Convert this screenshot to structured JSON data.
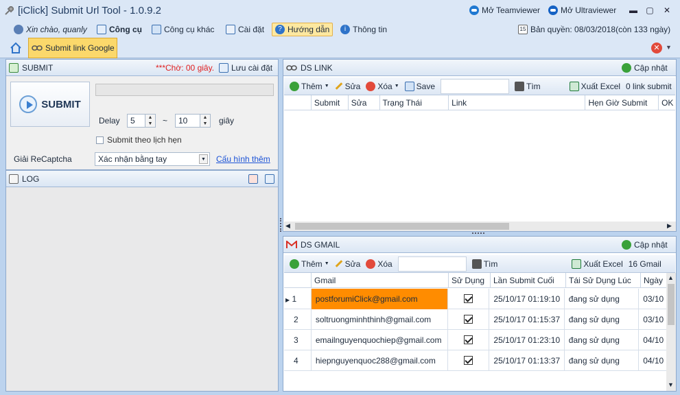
{
  "window": {
    "title": "[iClick] Submit Url Tool - 1.0.9.2",
    "teamviewer": "Mở Teamviewer",
    "ultraviewer": "Mở Ultraviewer",
    "minimize": "▬",
    "maximize": "▢",
    "close": "✕"
  },
  "menu": {
    "greeting": "Xin chào, quanly",
    "items": [
      "Công cụ",
      "Công cụ khác",
      "Cài đặt",
      "Hướng dẫn",
      "Thông tin"
    ],
    "license": "Bản quyền: 08/03/2018(còn 133 ngày)"
  },
  "tabs": {
    "active": "Submit link Google",
    "close": "✕",
    "dropdown": "▼"
  },
  "submit_panel": {
    "title": "SUBMIT",
    "wait_status": "***Chờ: 00 giây.",
    "save_settings": "Lưu cài đặt",
    "submit_button": "SUBMIT",
    "delay_label": "Delay",
    "delay_min": "5",
    "delay_sep": "~",
    "delay_max": "10",
    "delay_unit": "giây",
    "schedule_label": "Submit theo lịch hẹn",
    "recaptcha_label": "Giải ReCaptcha",
    "recaptcha_value": "Xác nhận bằng tay",
    "config_more": "Cấu hình thêm"
  },
  "log_panel": {
    "title": "LOG"
  },
  "dslink": {
    "title": "DS LINK",
    "update": "Cập nhật",
    "add": "Thêm",
    "edit": "Sửa",
    "delete": "Xóa",
    "save": "Save",
    "search": "Tìm",
    "export": "Xuất Excel",
    "count": "0 link submit",
    "columns": [
      "Submit",
      "Sửa",
      "Trạng Thái",
      "Link",
      "Hẹn Giờ Submit",
      "OK"
    ]
  },
  "dsgmail": {
    "title": "DS GMAIL",
    "update": "Cập nhật",
    "add": "Thêm",
    "edit": "Sửa",
    "delete": "Xóa",
    "search": "Tìm",
    "export": "Xuất Excel",
    "count": "16 Gmail",
    "columns": [
      "Gmail",
      "Sử Dụng",
      "Lần Submit Cuối",
      "Tái Sử Dụng Lúc",
      "Ngày"
    ],
    "rows": [
      {
        "num": "1",
        "gmail": "postforumiClick@gmail.com",
        "last": "25/10/17 01:19:10",
        "reuse": "đang sử dụng",
        "date": "03/10"
      },
      {
        "num": "2",
        "gmail": "soltruongminhthinh@gmail.com",
        "last": "25/10/17 01:15:37",
        "reuse": "đang sử dụng",
        "date": "03/10"
      },
      {
        "num": "3",
        "gmail": "emailnguyenquochiep@gmail.com",
        "last": "25/10/17 01:23:10",
        "reuse": "đang sử dụng",
        "date": "04/10"
      },
      {
        "num": "4",
        "gmail": "hiepnguyenquoc288@gmail.com",
        "last": "25/10/17 01:13:37",
        "reuse": "đang sử dụng",
        "date": "04/10"
      }
    ]
  },
  "colors": {
    "accent_tab": "#fbd86b",
    "selected_cell": "#ff8c00",
    "wait_text": "#e02020",
    "link": "#1b52d6"
  }
}
